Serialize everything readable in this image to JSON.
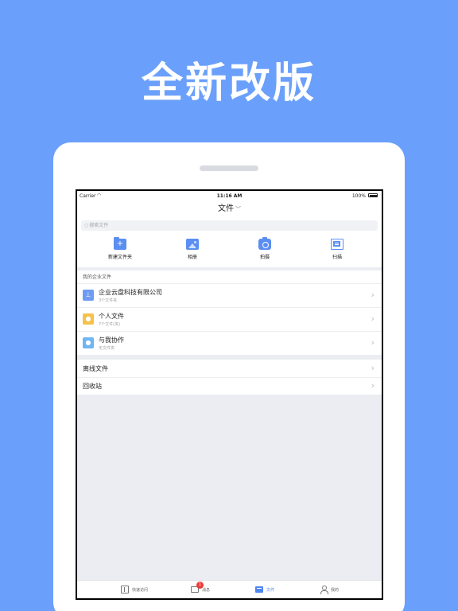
{
  "headline": "全新改版",
  "status_bar": {
    "carrier": "Carrier",
    "time": "11:16 AM",
    "battery": "100%"
  },
  "nav": {
    "title": "文件"
  },
  "search": {
    "placeholder": "搜索文件"
  },
  "quick_actions": [
    {
      "label": "新建文件夹",
      "icon": "new-folder-icon"
    },
    {
      "label": "相册",
      "icon": "photo-album-icon"
    },
    {
      "label": "拍摄",
      "icon": "camera-icon"
    },
    {
      "label": "扫描",
      "icon": "scan-icon"
    }
  ],
  "enterprise_section": {
    "label": "我的企业文件",
    "items": [
      {
        "title": "企业云盘科技有限公司",
        "subtitle": "3个文件夹",
        "icon": "org-icon",
        "color": "#6f9cf2"
      },
      {
        "title": "个人文件",
        "subtitle": "7个文件(夹)",
        "icon": "person-icon",
        "color": "#f5c24c"
      },
      {
        "title": "与我协作",
        "subtitle": "无文件夹",
        "icon": "collab-icon",
        "color": "#6fb6f2"
      }
    ]
  },
  "other_items": [
    {
      "title": "离线文件"
    },
    {
      "title": "回收站"
    }
  ],
  "tabbar": {
    "items": [
      {
        "label": "快速访问",
        "icon": "quick-access-icon"
      },
      {
        "label": "消息",
        "icon": "message-icon",
        "badge": "1"
      },
      {
        "label": "文件",
        "icon": "file-icon",
        "active": true
      },
      {
        "label": "我的",
        "icon": "profile-icon"
      }
    ]
  },
  "colors": {
    "background": "#6aa0fb",
    "accent": "#4f86ef",
    "badge": "#ef3b3b"
  }
}
